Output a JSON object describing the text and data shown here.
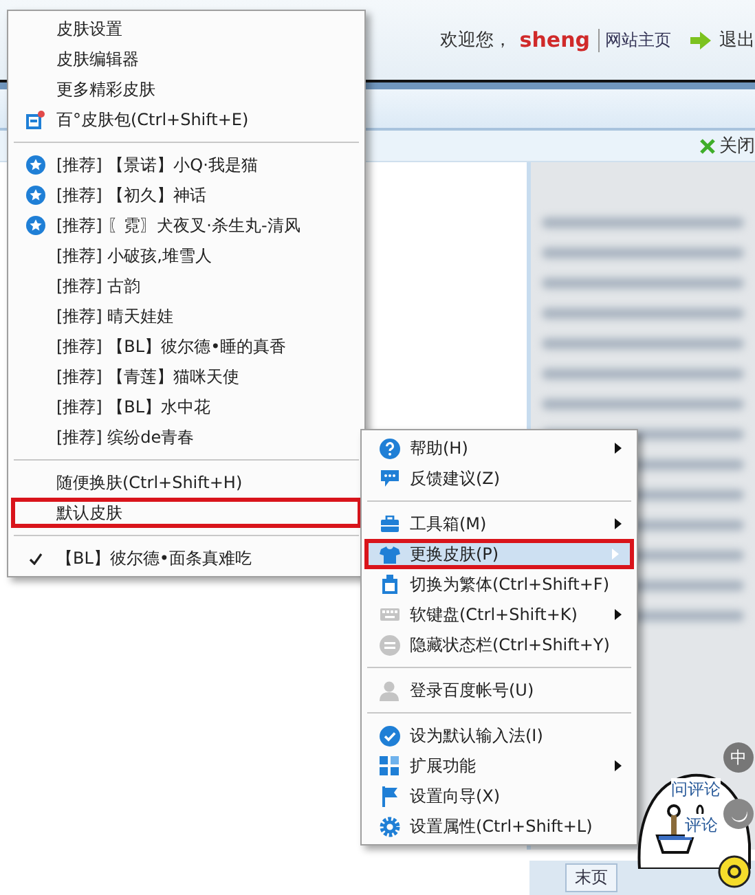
{
  "header": {
    "welcome": "欢迎您，",
    "user": "sheng",
    "home_link": "网站主页",
    "logout": "退出"
  },
  "tab_bar": {
    "close": "关闭"
  },
  "footer": {
    "last_page": "末页",
    "comment_1": "问评论",
    "comment_2": "评论"
  },
  "skin_menu": {
    "items": [
      {
        "kind": "item",
        "label": "皮肤设置",
        "starred": false,
        "checked": false,
        "highlighted": false
      },
      {
        "kind": "item",
        "label": "皮肤编辑器",
        "starred": false,
        "checked": false,
        "highlighted": false
      },
      {
        "kind": "item",
        "label": "更多精彩皮肤",
        "starred": false,
        "checked": false,
        "highlighted": false
      },
      {
        "kind": "item",
        "label": "百°皮肤包(Ctrl+Shift+E)",
        "starred": false,
        "checked": false,
        "highlighted": false,
        "icon": true
      },
      {
        "kind": "separator"
      },
      {
        "kind": "item",
        "label": "[推荐] 【景诺】小Q·我是猫",
        "starred": true,
        "checked": false,
        "highlighted": false
      },
      {
        "kind": "item",
        "label": "[推荐] 【初久】神话",
        "starred": true,
        "checked": false,
        "highlighted": false
      },
      {
        "kind": "item",
        "label": "[推荐] 〖霓〗犬夜叉·杀生丸-清风",
        "starred": true,
        "checked": false,
        "highlighted": false
      },
      {
        "kind": "item",
        "label": "[推荐] 小破孩,堆雪人",
        "starred": false,
        "checked": false,
        "highlighted": false
      },
      {
        "kind": "item",
        "label": "[推荐] 古韵",
        "starred": false,
        "checked": false,
        "highlighted": false
      },
      {
        "kind": "item",
        "label": "[推荐] 晴天娃娃",
        "starred": false,
        "checked": false,
        "highlighted": false
      },
      {
        "kind": "item",
        "label": "[推荐] 【BL】彼尔德•睡的真香",
        "starred": false,
        "checked": false,
        "highlighted": false
      },
      {
        "kind": "item",
        "label": "[推荐] 【青莲】猫咪天使",
        "starred": false,
        "checked": false,
        "highlighted": false
      },
      {
        "kind": "item",
        "label": "[推荐] 【BL】水中花",
        "starred": false,
        "checked": false,
        "highlighted": false
      },
      {
        "kind": "item",
        "label": "[推荐] 缤纷de青春",
        "starred": false,
        "checked": false,
        "highlighted": false
      },
      {
        "kind": "separator"
      },
      {
        "kind": "item",
        "label": "随便换肤(Ctrl+Shift+H)",
        "starred": false,
        "checked": false,
        "highlighted": false
      },
      {
        "kind": "item",
        "label": "默认皮肤",
        "starred": false,
        "checked": false,
        "highlighted": true
      },
      {
        "kind": "separator"
      },
      {
        "kind": "item",
        "label": "【BL】彼尔德•面条真难吃",
        "starred": false,
        "checked": true,
        "highlighted": false
      }
    ]
  },
  "main_menu": {
    "items": [
      {
        "kind": "item",
        "label": "帮助(H)",
        "submenu": true,
        "selected": false,
        "highlighted": false
      },
      {
        "kind": "item",
        "label": "反馈建议(Z)",
        "submenu": false,
        "selected": false,
        "highlighted": false
      },
      {
        "kind": "separator"
      },
      {
        "kind": "item",
        "label": "工具箱(M)",
        "submenu": true,
        "selected": false,
        "highlighted": false
      },
      {
        "kind": "item",
        "label": "更换皮肤(P)",
        "submenu": true,
        "selected": true,
        "highlighted": true
      },
      {
        "kind": "item",
        "label": "切换为繁体(Ctrl+Shift+F)",
        "submenu": false,
        "selected": false,
        "highlighted": false
      },
      {
        "kind": "item",
        "label": "软键盘(Ctrl+Shift+K)",
        "submenu": true,
        "selected": false,
        "highlighted": false
      },
      {
        "kind": "item",
        "label": "隐藏状态栏(Ctrl+Shift+Y)",
        "submenu": false,
        "selected": false,
        "highlighted": false
      },
      {
        "kind": "separator"
      },
      {
        "kind": "item",
        "label": "登录百度帐号(U)",
        "submenu": false,
        "selected": false,
        "highlighted": false
      },
      {
        "kind": "separator"
      },
      {
        "kind": "item",
        "label": "设为默认输入法(I)",
        "submenu": false,
        "selected": false,
        "highlighted": false
      },
      {
        "kind": "item",
        "label": "扩展功能",
        "submenu": true,
        "selected": false,
        "highlighted": false
      },
      {
        "kind": "item",
        "label": "设置向导(X)",
        "submenu": false,
        "selected": false,
        "highlighted": false
      },
      {
        "kind": "item",
        "label": "设置属性(Ctrl+Shift+L)",
        "submenu": false,
        "selected": false,
        "highlighted": false
      }
    ]
  },
  "ime_status": {
    "mode": "中"
  }
}
